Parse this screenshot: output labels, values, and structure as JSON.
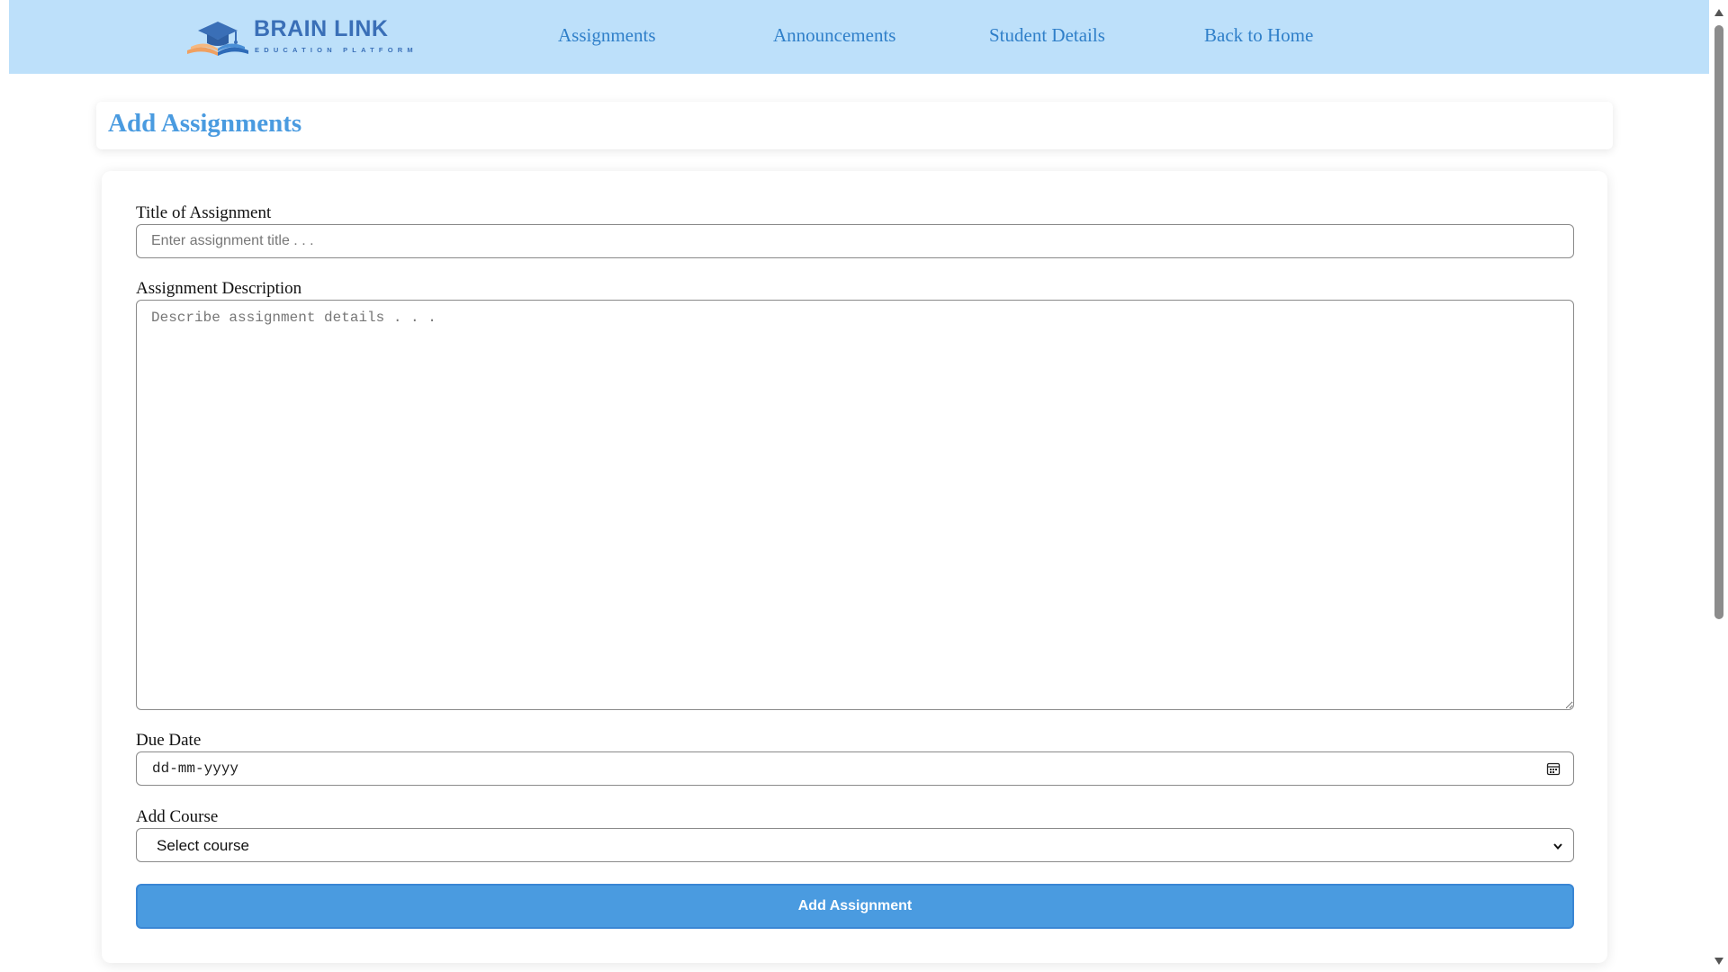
{
  "brand": {
    "name": "BRAIN LINK",
    "tagline": "EDUCATION PLATFORM",
    "colors": {
      "primary": "#3a6fb7",
      "accent": "#f0a060"
    }
  },
  "nav": {
    "items": [
      {
        "label": "Assignments"
      },
      {
        "label": "Announcements"
      },
      {
        "label": "Student Details"
      },
      {
        "label": "Back to Home"
      }
    ],
    "background": "#bde0fa",
    "link_color": "#2f7fc9"
  },
  "page": {
    "title": "Add Assignments",
    "title_color": "#4a9be0"
  },
  "form": {
    "title_field": {
      "label": "Title of Assignment",
      "value": "",
      "placeholder": "Enter assignment title . . ."
    },
    "description_field": {
      "label": "Assignment Description",
      "value": "",
      "placeholder": "Describe assignment details . . ."
    },
    "due_date_field": {
      "label": "Due Date",
      "display": "dd-mm-yyyy",
      "icon": "calendar-icon"
    },
    "course_field": {
      "label": "Add Course",
      "selected": "Select course",
      "icon": "chevron-down-icon"
    },
    "submit": {
      "label": "Add Assignment",
      "color": "#4a9be0"
    }
  }
}
